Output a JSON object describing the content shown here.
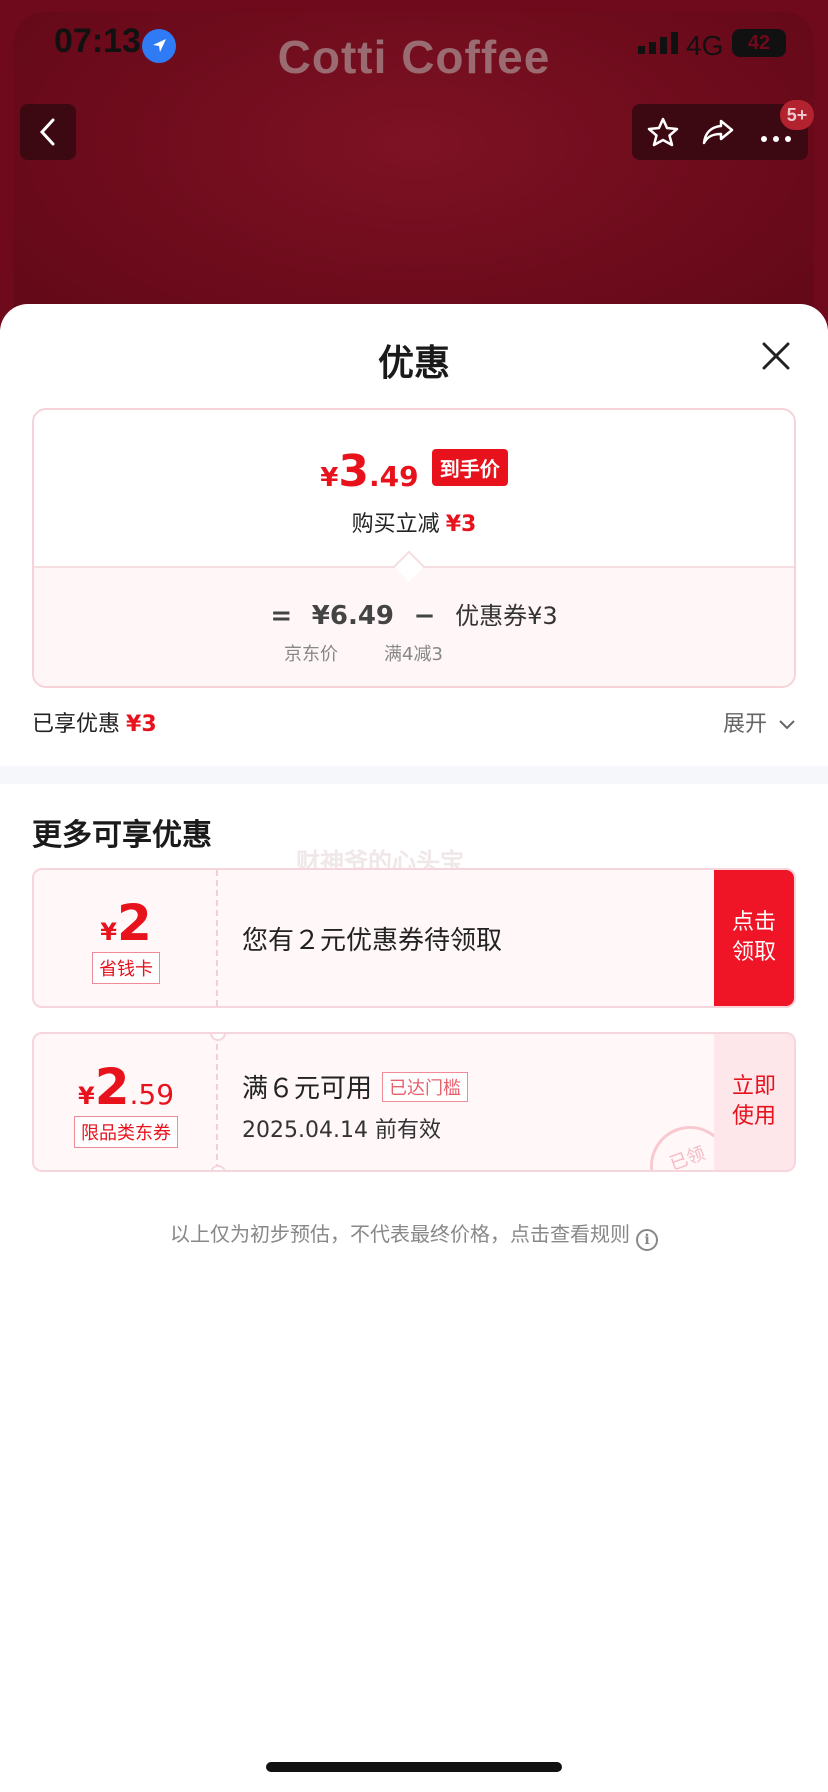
{
  "status_bar": {
    "time": "07:13",
    "network": "4G",
    "battery": "42"
  },
  "header": {
    "brand": "Cotti Coffee",
    "notification_badge": "5+"
  },
  "sheet": {
    "title": "优惠",
    "price": {
      "currency": "¥",
      "integer": "3",
      "decimal": ".49",
      "tag": "到手价"
    },
    "reduce": {
      "label": "购买立减",
      "amount": "¥3"
    },
    "formula": {
      "equals": "=",
      "jd_price": "¥6.49",
      "minus": "−",
      "coupon": "优惠券¥3",
      "jd_price_label": "京东价",
      "coupon_label": "满4减3"
    },
    "enjoyed": {
      "label": "已享优惠",
      "amount": "¥3",
      "expand": "展开"
    }
  },
  "more": {
    "title": "更多可享优惠",
    "watermark": "财神爷的心头宝",
    "coupons": [
      {
        "currency": "¥",
        "amount": "2",
        "decimal": "",
        "tag": "省钱卡",
        "desc": "您有２元优惠券待领取",
        "action": [
          "点击",
          "领取"
        ]
      },
      {
        "currency": "¥",
        "amount": "2",
        "decimal": ".59",
        "tag": "限品类东券",
        "desc": "满６元可用",
        "threshold": "已达门槛",
        "expiry": "2025.04.14 前有效",
        "stamp": "已领",
        "action": [
          "立即",
          "使用"
        ]
      }
    ]
  },
  "footnote": "以上仅为初步预估，不代表最终价格，点击查看规则",
  "colors": {
    "accent_red": "#e8121c",
    "header_bg": "#6e0a1c"
  }
}
